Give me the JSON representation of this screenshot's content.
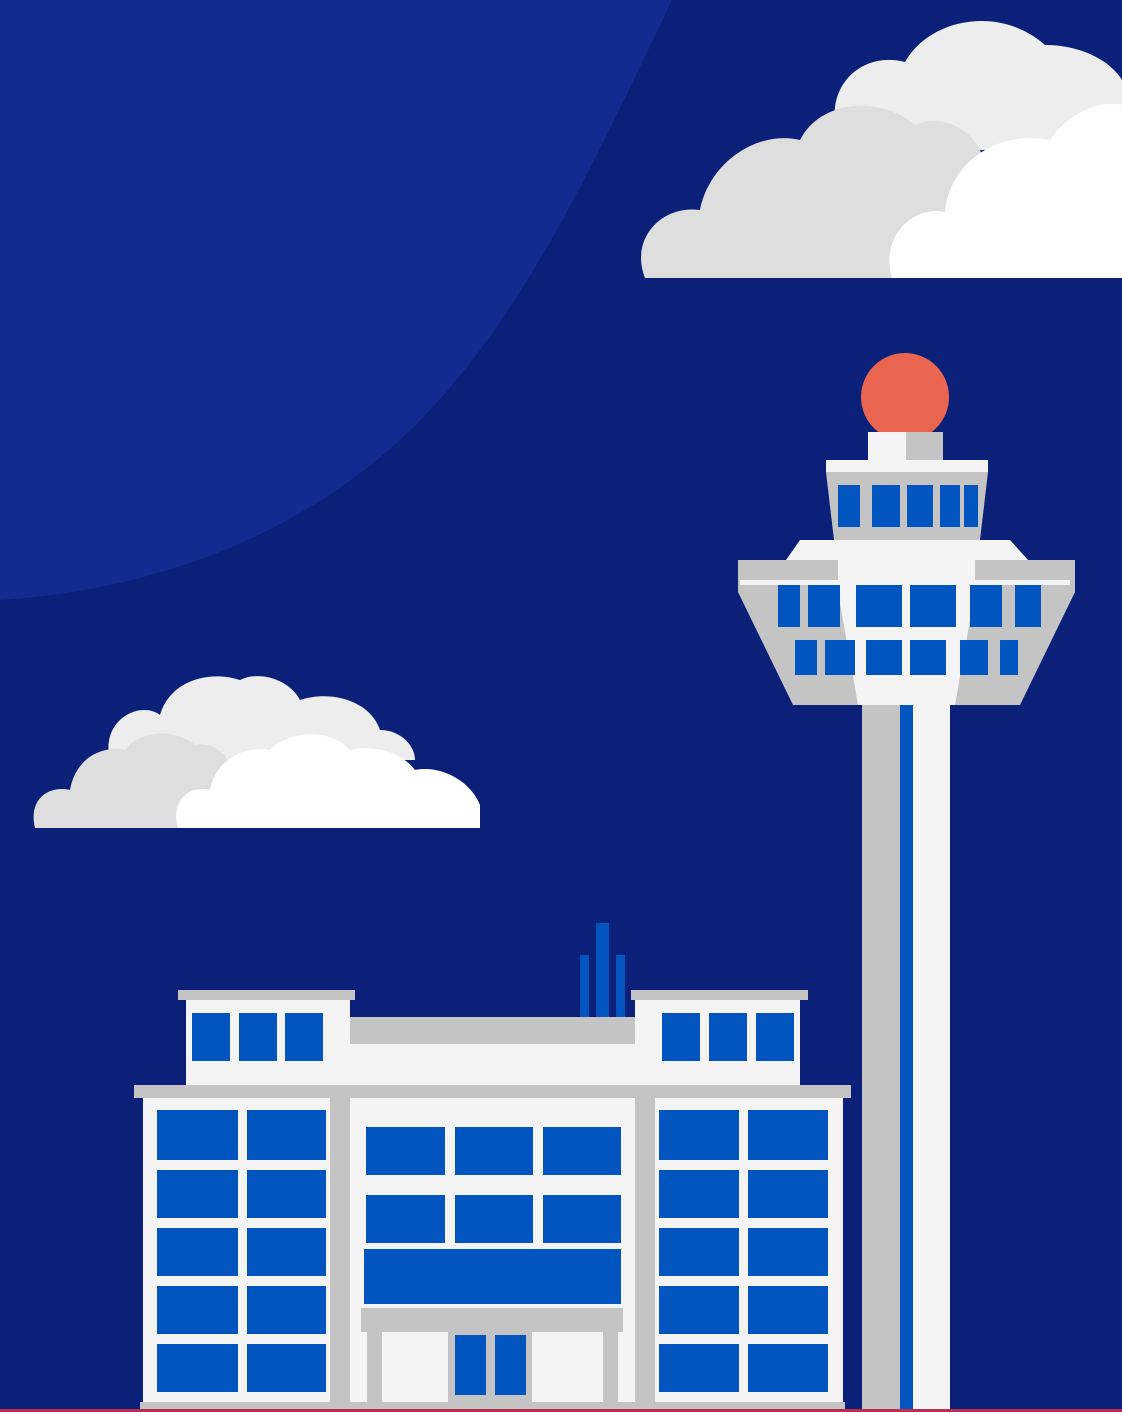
{
  "scene": {
    "subject": "airport-illustration",
    "colors": {
      "sky": "#0B2079",
      "sky_glow": "#122B91",
      "window_blue": "#0254BF",
      "building_white": "#F4F4F4",
      "building_grey": "#C4C4C4",
      "cloud_white": "#FFFFFF",
      "cloud_light": "#ECEDEC",
      "cloud_grey": "#DEDEDE",
      "beacon": "#EA6550",
      "ground_accent": "#B83050"
    },
    "icons": [
      "cloud-icon",
      "control-tower-icon",
      "terminal-building-icon",
      "antenna-icon",
      "beacon-icon"
    ]
  }
}
